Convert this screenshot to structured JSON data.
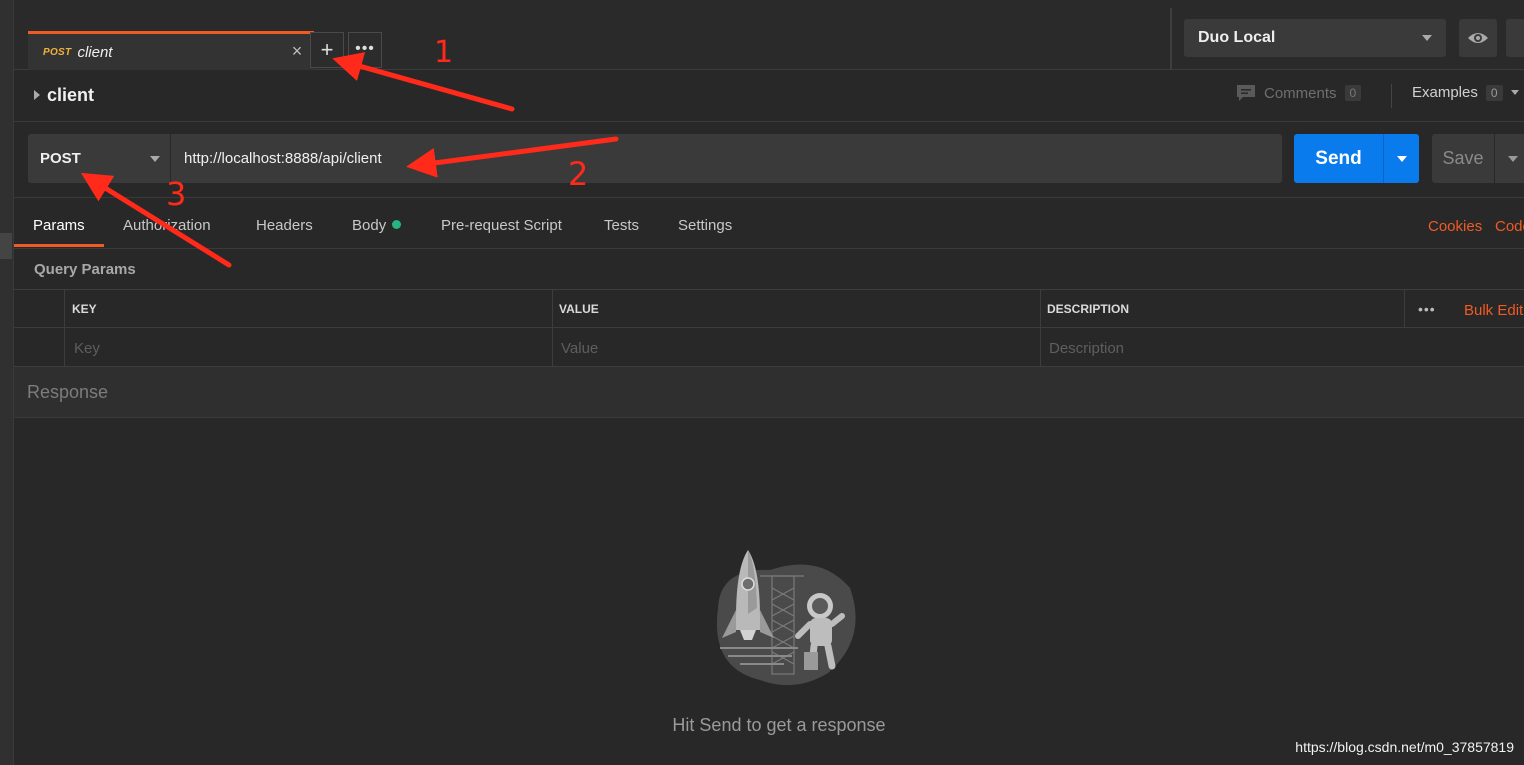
{
  "tab": {
    "method": "POST",
    "name": "client",
    "close_label": "×"
  },
  "toolbar": {
    "new_tab_label": "+",
    "more_tabs_label": "•••"
  },
  "environment": {
    "selected": "Duo Local"
  },
  "request": {
    "title": "client",
    "comments_label": "Comments",
    "comments_count": "0",
    "examples_label": "Examples",
    "examples_count": "0",
    "method": "POST",
    "url": "http://localhost:8888/api/client",
    "send_label": "Send",
    "save_label": "Save"
  },
  "params_tabs": [
    {
      "label": "Params"
    },
    {
      "label": "Authorization"
    },
    {
      "label": "Headers"
    },
    {
      "label": "Body"
    },
    {
      "label": "Pre-request Script"
    },
    {
      "label": "Tests"
    },
    {
      "label": "Settings"
    }
  ],
  "right_links": {
    "cookies": "Cookies",
    "code": "Code"
  },
  "query_params": {
    "title": "Query Params",
    "columns": [
      "KEY",
      "VALUE",
      "DESCRIPTION"
    ],
    "placeholders": [
      "Key",
      "Value",
      "Description"
    ],
    "more_label": "•••",
    "bulk_edit": "Bulk Edit"
  },
  "response": {
    "title": "Response",
    "hint": "Hit Send to get a response"
  },
  "annotations": [
    "1",
    "2",
    "3"
  ],
  "watermark": "https://blog.csdn.net/m0_37857819",
  "colors": {
    "accent": "#ef5b25",
    "send": "#097bed",
    "method": "#f2b33d",
    "body_dot": "#26b47f",
    "annotation": "#ff2a1a"
  }
}
